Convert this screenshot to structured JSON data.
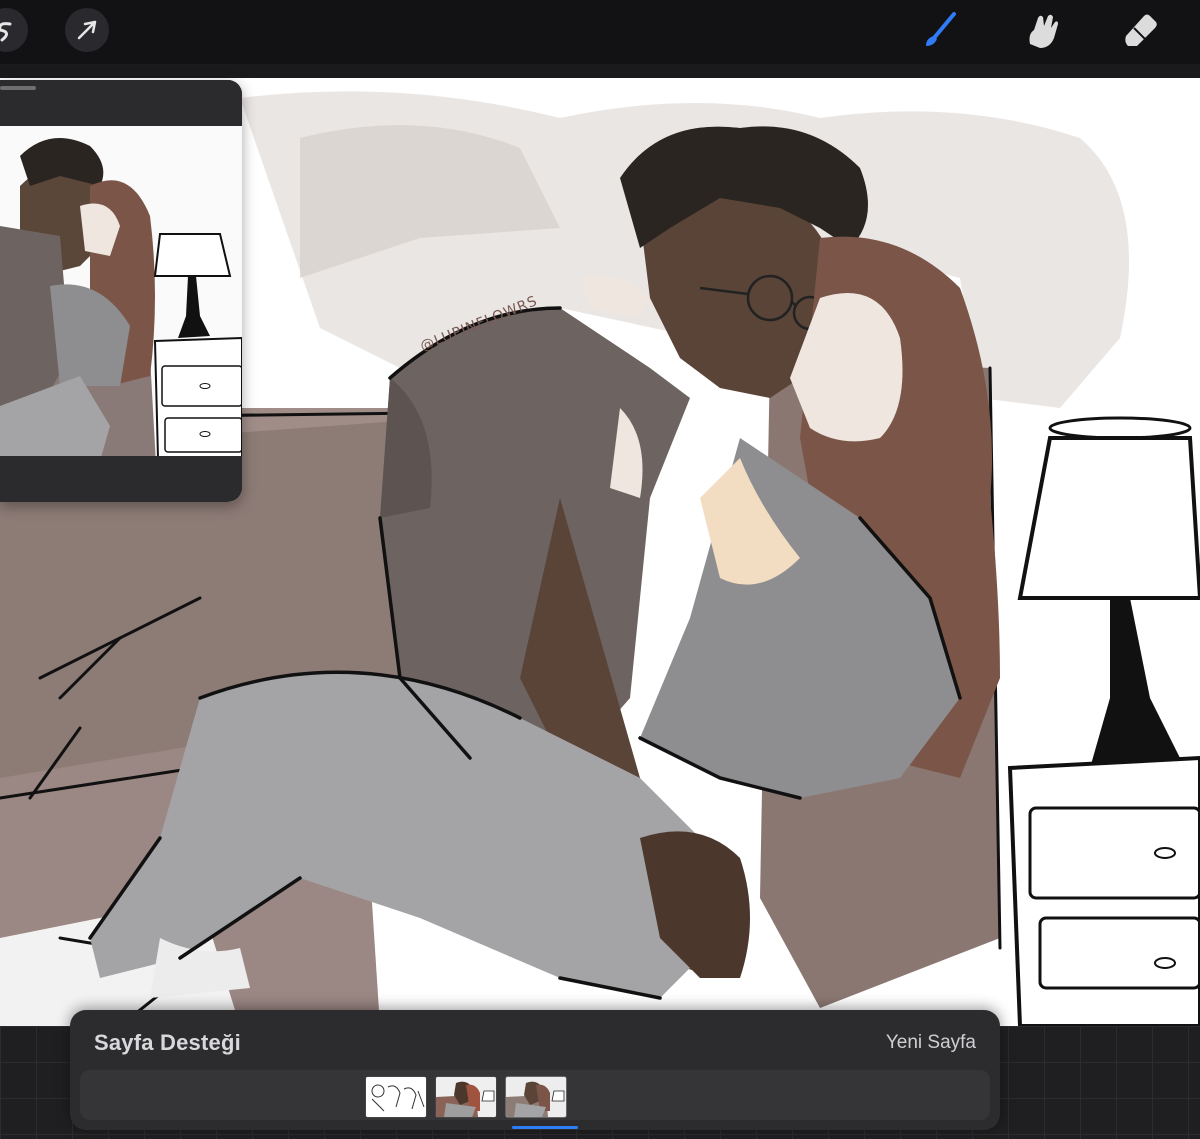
{
  "toolbar": {
    "left_icons": [
      "selection-s-icon",
      "transform-arrow-icon"
    ],
    "right_icons": [
      "brush-icon",
      "smudge-icon",
      "eraser-icon"
    ],
    "active_tool": "brush",
    "active_color": "#2f7cf6"
  },
  "canvas": {
    "watermark": "@LUPINFLOWRS"
  },
  "reference_window": {
    "content": "reference-sketch-image"
  },
  "pages_panel": {
    "title": "Sayfa Desteği",
    "new_page_label": "Yeni Sayfa",
    "thumbnails": [
      "page-1",
      "page-2",
      "page-3"
    ],
    "selected_index": 2
  },
  "colors": {
    "toolbar_bg": "#121214",
    "panel_bg": "#2c2c2e",
    "accent": "#2e7cf6"
  }
}
